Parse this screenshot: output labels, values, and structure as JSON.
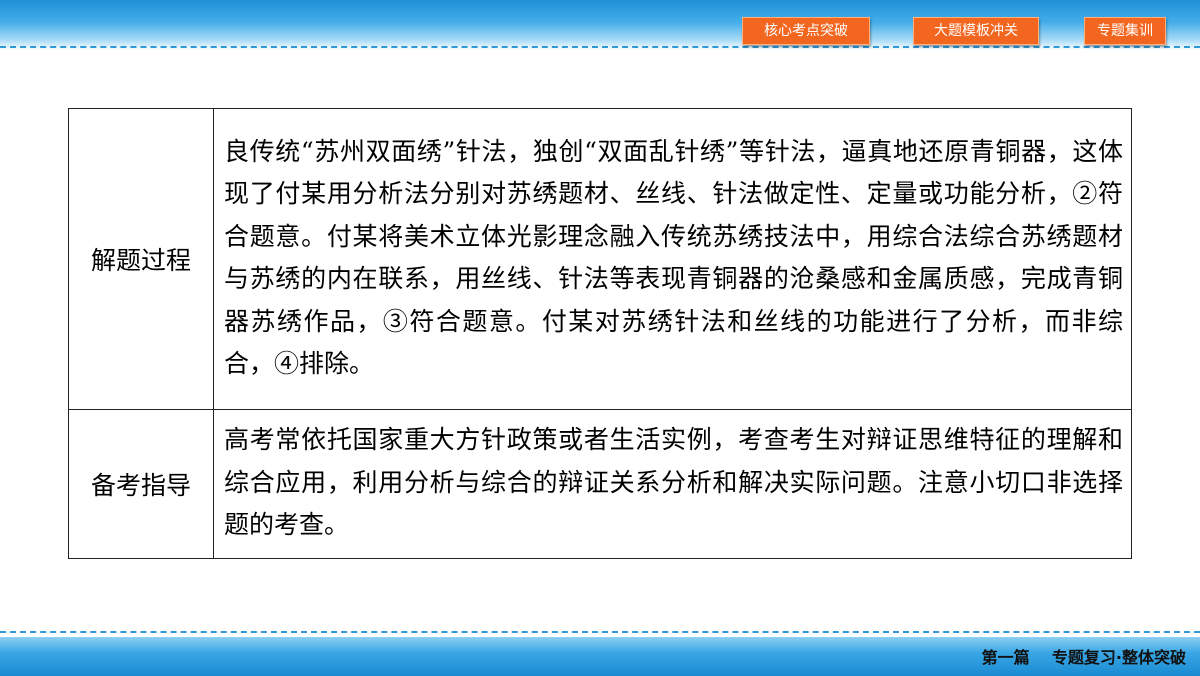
{
  "header": {
    "nav": [
      {
        "label": "核心考点突破"
      },
      {
        "label": "大题模板冲关"
      },
      {
        "label": "专题集训"
      }
    ]
  },
  "table": {
    "rows": [
      {
        "label": "解题过程",
        "text": "良传统“苏州双面绣”针法，独创“双面乱针绣”等针法，逼真地还原青铜器，这体现了付某用分析法分别对苏绣题材、丝线、针法做定性、定量或功能分析，②符合题意。付某将美术立体光影理念融入传统苏绣技法中，用综合法综合苏绣题材与苏绣的内在联系，用丝线、针法等表现青铜器的沧桑感和金属质感，完成青铜器苏绣作品，③符合题意。付某对苏绣针法和丝线的功能进行了分析，而非综合，④排除。"
      },
      {
        "label": "备考指导",
        "text": "高考常依托国家重大方针政策或者生活实例，考查考生对辩证思维特征的理解和综合应用，利用分析与综合的辩证关系分析和解决实际问题。注意小切口非选择题的考查。"
      }
    ]
  },
  "footer": {
    "part": "第一篇",
    "title": "专题复习·整体突破"
  },
  "colors": {
    "nav_bg": "#f2661f",
    "band_blue": "#1d90d6"
  }
}
